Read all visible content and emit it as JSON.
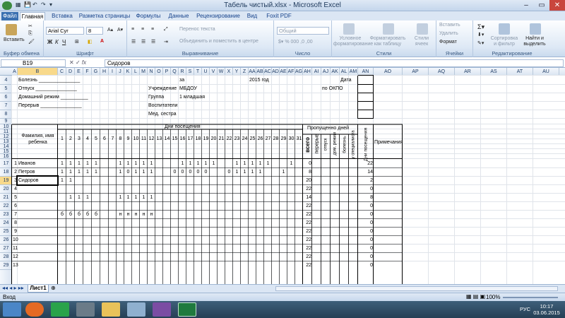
{
  "window": {
    "title": "Табель чистый.xlsx - Microsoft Excel"
  },
  "tabs": [
    {
      "label": "Файл"
    },
    {
      "label": "Главная"
    },
    {
      "label": "Вставка"
    },
    {
      "label": "Разметка страницы"
    },
    {
      "label": "Формулы"
    },
    {
      "label": "Данные"
    },
    {
      "label": "Рецензирование"
    },
    {
      "label": "Вид"
    },
    {
      "label": "Foxit PDF"
    }
  ],
  "ribbon": {
    "clipboard": {
      "label": "Буфер обмена",
      "paste": "Вставить"
    },
    "font": {
      "label": "Шрифт",
      "name": "Arial Cyr",
      "size": "8"
    },
    "alignment": {
      "label": "Выравнивание",
      "wrap": "Перенос текста",
      "merge": "Объединить и поместить в центре"
    },
    "number": {
      "label": "Число",
      "format": "Общий"
    },
    "styles": {
      "label": "Стили",
      "conditional": "Условное форматирование",
      "table": "Форматировать как таблицу",
      "cell": "Стили ячеек"
    },
    "cells": {
      "label": "Ячейки",
      "insert": "Вставить",
      "delete": "Удалить",
      "format": "Формат"
    },
    "editing": {
      "label": "Редактирование",
      "sort": "Сортировка и фильтр",
      "find": "Найти и выделить"
    }
  },
  "formula": {
    "namebox": "B19",
    "fx": "fx",
    "value": "Сидоров"
  },
  "columns": [
    "A",
    "B",
    "C",
    "D",
    "E",
    "F",
    "G",
    "H",
    "I",
    "J",
    "K",
    "L",
    "M",
    "N",
    "O",
    "P",
    "Q",
    "R",
    "S",
    "T",
    "U",
    "V",
    "W",
    "X",
    "Y",
    "Z",
    "AA",
    "AB",
    "AC",
    "AD",
    "AE",
    "AF",
    "AG",
    "AH",
    "AI",
    "AJ",
    "AK",
    "AL",
    "AM",
    "AN",
    "AO",
    "AP",
    "AQ",
    "AR",
    "AS",
    "AT",
    "AU"
  ],
  "rows": [
    "4",
    "5",
    "6",
    "7",
    "8",
    "9",
    "10",
    "11",
    "12",
    "13",
    "14",
    "15",
    "16",
    "17",
    "18",
    "19",
    "20",
    "21",
    "22",
    "23",
    "24",
    "25",
    "26",
    "27",
    "28",
    "29"
  ],
  "sheet": {
    "header": {
      "bolezn": "Болезнь _______________",
      "otpusk": "Отпуск _______________",
      "dom": "Домашний режим __________",
      "pereryv": "Перерыв _______________",
      "za": "за",
      "year": "2015 год",
      "data": "Дата",
      "uchr": "Учреждение",
      "mbdou": "МБДОУ",
      "okpo": "по  ОКПО",
      "gruppa": "Группа",
      "gruppa_val": "1 младшая",
      "vosp": "Воспитатели",
      "medsestra": "Мед. сестра"
    },
    "table": {
      "fio": "Фамилия, имя ребенка",
      "days_title": "Дни  посещения",
      "days": [
        "1",
        "2",
        "3",
        "4",
        "5",
        "6",
        "7",
        "8",
        "9",
        "10",
        "11",
        "12",
        "13",
        "14",
        "15",
        "16",
        "17",
        "18",
        "19",
        "20",
        "21",
        "22",
        "23",
        "24",
        "25",
        "26",
        "27",
        "28",
        "29",
        "30",
        "31"
      ],
      "missed": "Пропущенно дней",
      "vsego": "всего",
      "pereryv": "перерыв",
      "otpusk": "отпуск",
      "dom": "дом. режим",
      "bolezn": "болезнь",
      "spec": "у специалиста",
      "dni_pos": "Дни посещения",
      "notes": "Примечания"
    },
    "children": [
      {
        "row": "17",
        "n": "1",
        "name": "Иванов",
        "marks": {
          "1": "1",
          "2": "1",
          "3": "1",
          "4": "1",
          "5": "1",
          "8": "1",
          "9": "1",
          "10": "1",
          "11": "1",
          "12": "1",
          "16": "1",
          "17": "1",
          "18": "1",
          "19": "1",
          "20": "1",
          "23": "1",
          "24": "1",
          "25": "1",
          "26": "1",
          "27": "1",
          "30": "1"
        },
        "vsego": "0",
        "days": "22"
      },
      {
        "row": "18",
        "n": "2",
        "name": "Петров",
        "marks": {
          "1": "1",
          "2": "1",
          "3": "1",
          "4": "1",
          "5": "1",
          "8": "1",
          "9": "0",
          "10": "1",
          "11": "1",
          "12": "1",
          "15": "0",
          "16": "0",
          "17": "0",
          "18": "0",
          "19": "0",
          "22": "0",
          "23": "1",
          "24": "1",
          "25": "1",
          "26": "1",
          "29": "1"
        },
        "vsego": "8",
        "days": "14"
      },
      {
        "row": "19",
        "n": "3",
        "name": "Сидоров",
        "marks": {
          "1": "1",
          "2": "1"
        },
        "vsego": "20",
        "days": "2"
      },
      {
        "row": "20",
        "n": "4",
        "name": "",
        "marks": {},
        "vsego": "22",
        "days": "0"
      },
      {
        "row": "21",
        "n": "5",
        "name": "",
        "marks": {
          "2": "1",
          "3": "1",
          "4": "1",
          "8": "1",
          "9": "1",
          "10": "1",
          "11": "1",
          "12": "1"
        },
        "vsego": "14",
        "days": "8"
      },
      {
        "row": "22",
        "n": "6",
        "name": "",
        "marks": {},
        "vsego": "22",
        "days": "0"
      },
      {
        "row": "23",
        "n": "7",
        "name": "",
        "marks": {
          "1": "б",
          "2": "б",
          "3": "б",
          "4": "б",
          "5": "б",
          "8": "н",
          "9": "н",
          "10": "н",
          "11": "н",
          "12": "н"
        },
        "vsego": "22",
        "days": "0"
      },
      {
        "row": "24",
        "n": "8",
        "name": "",
        "marks": {},
        "vsego": "22",
        "days": "0"
      },
      {
        "row": "25",
        "n": "9",
        "name": "",
        "marks": {},
        "vsego": "22",
        "days": "0"
      },
      {
        "row": "26",
        "n": "10",
        "name": "",
        "marks": {},
        "vsego": "22",
        "days": "0"
      },
      {
        "row": "27",
        "n": "11",
        "name": "",
        "marks": {},
        "vsego": "22",
        "days": "0"
      },
      {
        "row": "28",
        "n": "12",
        "name": "",
        "marks": {},
        "vsego": "22",
        "days": "0"
      },
      {
        "row": "29",
        "n": "13",
        "name": "",
        "marks": {},
        "vsego": "22",
        "days": "0"
      }
    ]
  },
  "sheettab": "Лист1",
  "status": {
    "ready": "Вход",
    "zoom": "100%"
  },
  "taskbar": {
    "lang": "РУС",
    "time": "10:17",
    "date": "03.06.2015"
  }
}
